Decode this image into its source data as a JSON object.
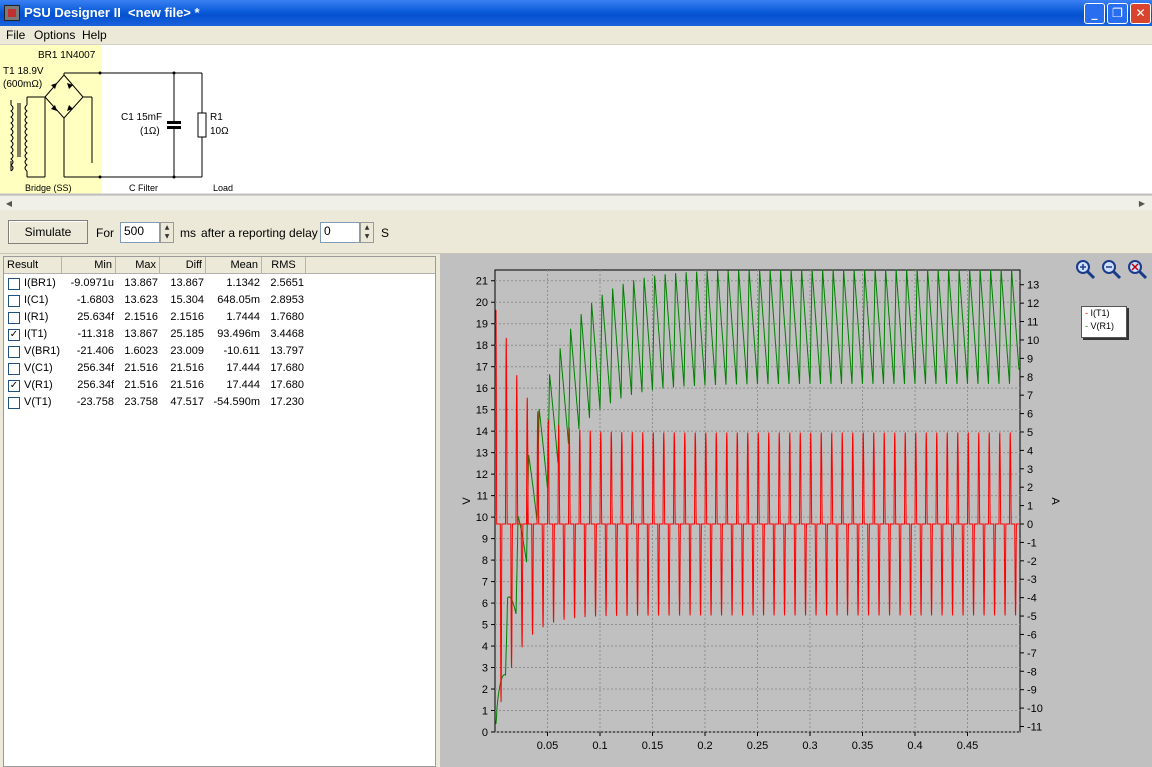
{
  "window": {
    "title": "PSU Designer II  <new file> *",
    "min_glyph": "_",
    "max_glyph": "❐",
    "close_glyph": "✕"
  },
  "menu": [
    "File",
    "Options",
    "Help"
  ],
  "schematic": {
    "bridge_part": "BR1 1N4007",
    "transformer": "T1 18.9V",
    "transformer_r": "(600mΩ)",
    "cap": "C1 15mF",
    "cap_r": "(1Ω)",
    "res": "R1",
    "res_val": "10Ω",
    "stage_bridge": "Bridge (SS)",
    "stage_filter": "C Filter",
    "stage_load": "Load"
  },
  "toolbar": {
    "simulate_label": "Simulate",
    "for_label": "For",
    "duration_value": "500",
    "ms_label": "ms",
    "delay_label": "after a reporting delay of",
    "delay_value": "0",
    "s_label": "S"
  },
  "results": {
    "headers": [
      "Result",
      "Min",
      "Max",
      "Diff",
      "Mean",
      "RMS"
    ],
    "rows": [
      {
        "checked": false,
        "name": "I(BR1)",
        "min": "-9.0971u",
        "max": "13.867",
        "diff": "13.867",
        "mean": "1.1342",
        "rms": "2.5651"
      },
      {
        "checked": false,
        "name": "I(C1)",
        "min": "-1.6803",
        "max": "13.623",
        "diff": "15.304",
        "mean": "648.05m",
        "rms": "2.8953"
      },
      {
        "checked": false,
        "name": "I(R1)",
        "min": "25.634f",
        "max": "2.1516",
        "diff": "2.1516",
        "mean": "1.7444",
        "rms": "1.7680"
      },
      {
        "checked": true,
        "name": "I(T1)",
        "min": "-11.318",
        "max": "13.867",
        "diff": "25.185",
        "mean": "93.496m",
        "rms": "3.4468"
      },
      {
        "checked": false,
        "name": "V(BR1)",
        "min": "-21.406",
        "max": "1.6023",
        "diff": "23.009",
        "mean": "-10.611",
        "rms": "13.797"
      },
      {
        "checked": false,
        "name": "V(C1)",
        "min": "256.34f",
        "max": "21.516",
        "diff": "21.516",
        "mean": "17.444",
        "rms": "17.680"
      },
      {
        "checked": true,
        "name": "V(R1)",
        "min": "256.34f",
        "max": "21.516",
        "diff": "21.516",
        "mean": "17.444",
        "rms": "17.680"
      },
      {
        "checked": false,
        "name": "V(T1)",
        "min": "-23.758",
        "max": "23.758",
        "diff": "47.517",
        "mean": "-54.590m",
        "rms": "17.230"
      }
    ]
  },
  "chart_data": {
    "type": "line",
    "xlabel": "",
    "ylabel": "V",
    "y2label": "A",
    "xlim": [
      0,
      0.5
    ],
    "ylim": [
      0,
      21.5
    ],
    "y2lim": [
      -11.3,
      13.8
    ],
    "x_ticks": [
      "0.05",
      "0.1",
      "0.15",
      "0.2",
      "0.25",
      "0.3",
      "0.35",
      "0.4",
      "0.45"
    ],
    "y_ticks": [
      "0",
      "1",
      "2",
      "3",
      "4",
      "5",
      "6",
      "7",
      "8",
      "9",
      "10",
      "11",
      "12",
      "13",
      "14",
      "15",
      "16",
      "17",
      "18",
      "19",
      "20",
      "21"
    ],
    "y2_ticks": [
      "-11",
      "-10",
      "-9",
      "-8",
      "-7",
      "-6",
      "-5",
      "-4",
      "-3",
      "-2",
      "-1",
      "0",
      "1",
      "2",
      "3",
      "4",
      "5",
      "6",
      "7",
      "8",
      "9",
      "10",
      "11",
      "12",
      "13"
    ],
    "grid": true,
    "legend_position": "top-right outside",
    "series": [
      {
        "name": "I(T1)",
        "axis": "right",
        "color": "#ff0000",
        "period": 0.01,
        "steady_peak": 5.0,
        "min": -11.318,
        "max": 13.867
      },
      {
        "name": "V(R1)",
        "axis": "left",
        "color": "#008000",
        "period": 0.01,
        "steady_peak": 21.516,
        "steady_trough": 16.2,
        "min": 0,
        "max": 21.516
      }
    ]
  },
  "colors": {
    "titlebar": "#0a5bd8",
    "schematic_highlight": "#ffffc0",
    "graph_bg": "#c0c0c0",
    "series_current": "#ff0000",
    "series_voltage": "#008000"
  },
  "icons": [
    "zoom-in-icon",
    "zoom-out-icon",
    "zoom-reset-icon"
  ]
}
